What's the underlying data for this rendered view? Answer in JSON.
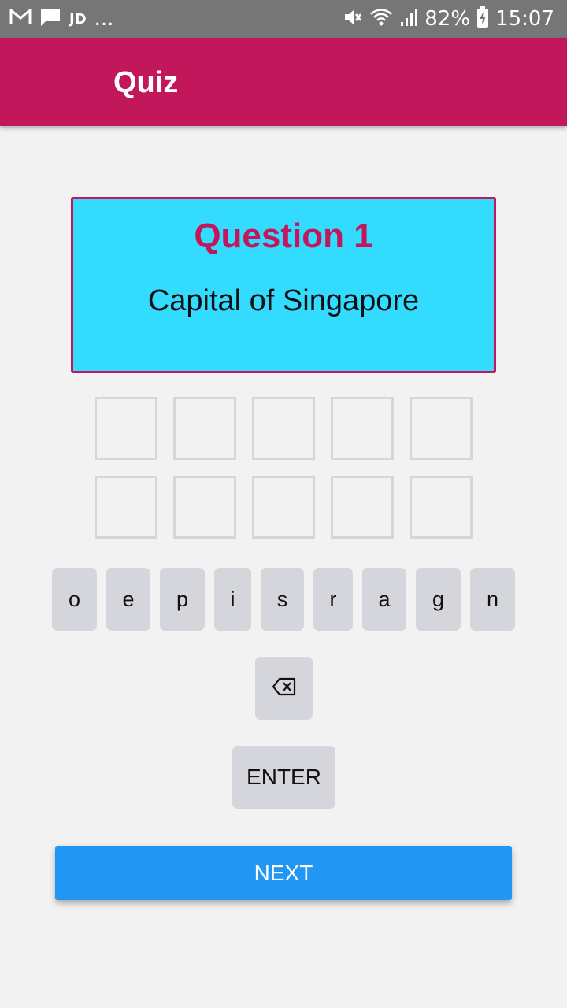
{
  "status_bar": {
    "app_label": "JD",
    "more": "...",
    "battery": "82%",
    "time": "15:07",
    "icons": [
      "gmail-icon",
      "message-icon",
      "mute-icon",
      "wifi-icon",
      "signal-icon",
      "battery-charging-icon"
    ]
  },
  "app_bar": {
    "title": "Quiz"
  },
  "question": {
    "number_label": "Question 1",
    "text": "Capital of Singapore"
  },
  "answer_slots": {
    "count": 10,
    "values": [
      "",
      "",
      "",
      "",
      "",
      "",
      "",
      "",
      "",
      ""
    ]
  },
  "letter_keys": [
    "o",
    "e",
    "p",
    "i",
    "s",
    "r",
    "a",
    "g",
    "n"
  ],
  "controls": {
    "backspace_icon": "backspace-icon",
    "enter_label": "ENTER",
    "next_label": "NEXT"
  },
  "colors": {
    "primary": "#c2185b",
    "card": "#33dbff",
    "key": "#d4d6db",
    "next": "#2196f3",
    "background": "#f2f2f2"
  }
}
